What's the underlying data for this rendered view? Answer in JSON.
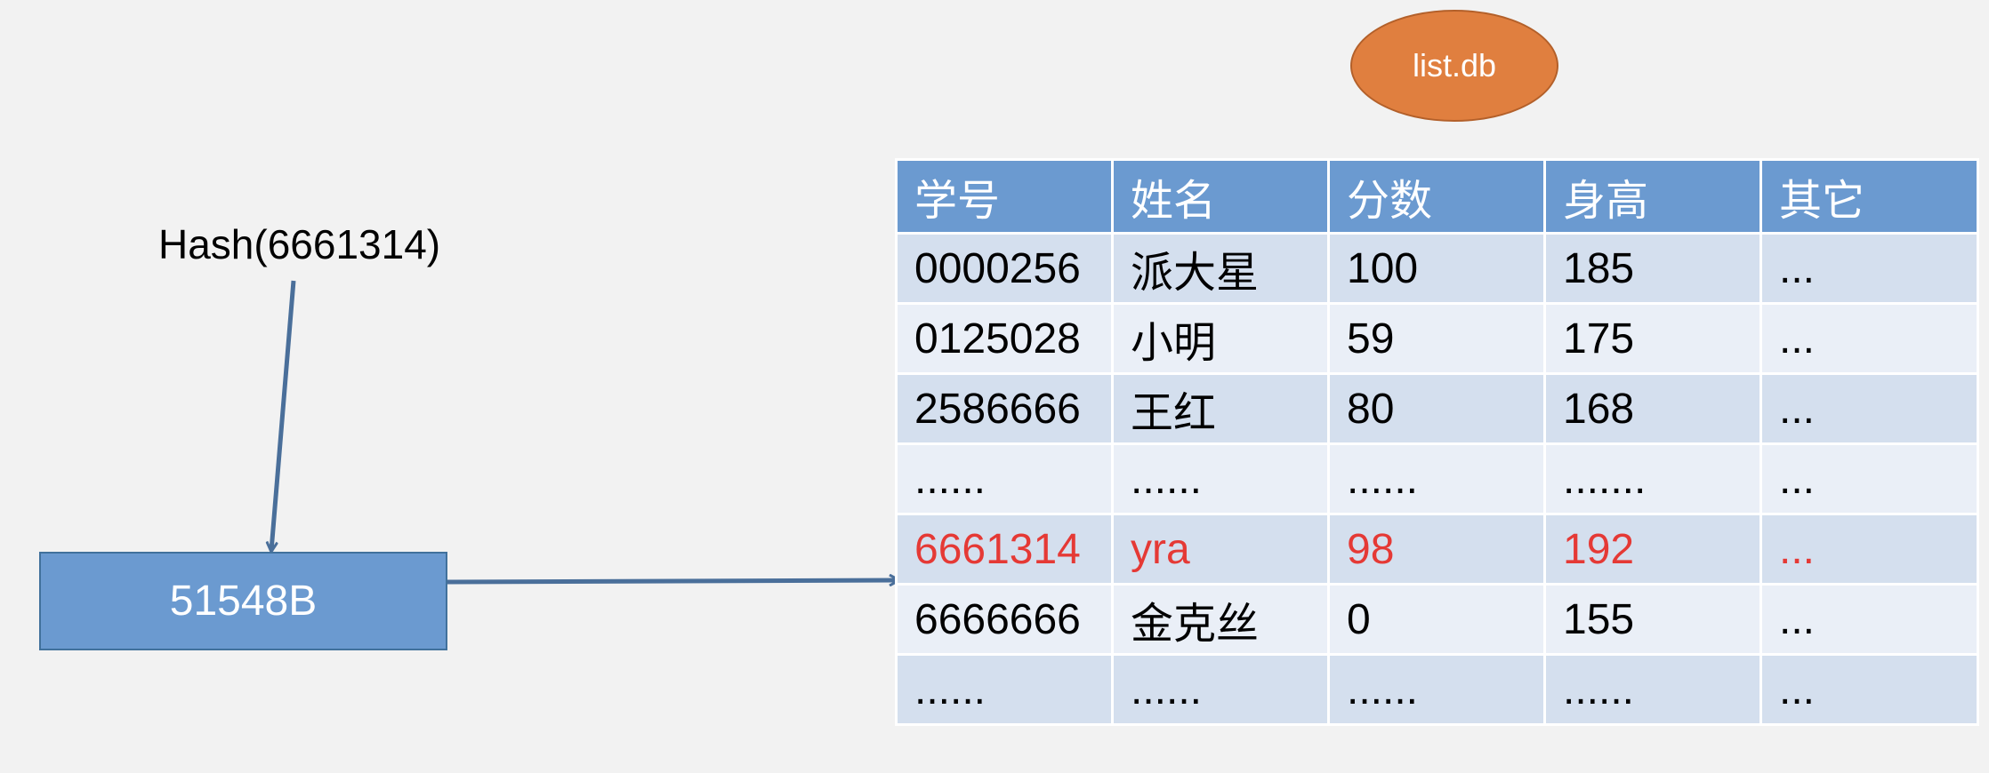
{
  "db_label": "list.db",
  "hash_expression": "Hash(6661314)",
  "hash_result": "51548B",
  "table": {
    "headers": [
      "学号",
      "姓名",
      "分数",
      "身高",
      "其它"
    ],
    "rows": [
      {
        "cells": [
          "0000256",
          "派大星",
          "100",
          "185",
          "..."
        ],
        "highlight": false
      },
      {
        "cells": [
          "0125028",
          "小明",
          "59",
          "175",
          "..."
        ],
        "highlight": false
      },
      {
        "cells": [
          "2586666",
          "王红",
          "80",
          "168",
          "..."
        ],
        "highlight": false
      },
      {
        "cells": [
          "......",
          "......",
          "......",
          ".......",
          "..."
        ],
        "highlight": false
      },
      {
        "cells": [
          "6661314",
          "yra",
          "98",
          "192",
          "..."
        ],
        "highlight": true
      },
      {
        "cells": [
          "6666666",
          "金克丝",
          "0",
          "155",
          "..."
        ],
        "highlight": false
      },
      {
        "cells": [
          "......",
          "......",
          "......",
          "......",
          "..."
        ],
        "highlight": false
      }
    ]
  },
  "colors": {
    "header_bg": "#6b9ad0",
    "row_dark": "#d4dfee",
    "row_light": "#eaeff7",
    "highlight_text": "#e53935",
    "arrow": "#4a6f9a",
    "ellipse": "#e07f3f"
  }
}
